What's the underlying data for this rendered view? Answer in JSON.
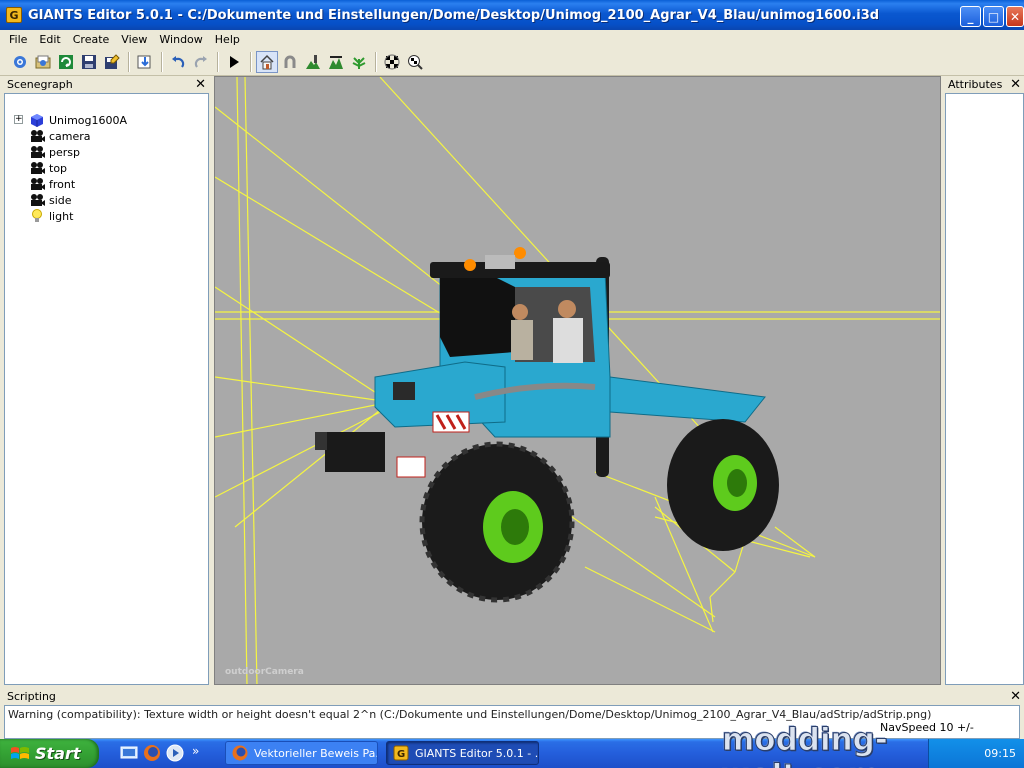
{
  "window": {
    "title": "GIANTS Editor 5.0.1 - C:/Dokumente und Einstellungen/Dome/Desktop/Unimog_2100_Agrar_V4_Blau/unimog1600.i3d",
    "app_icon_letter": "G",
    "minimize_glyph": "_",
    "maximize_glyph": "□",
    "close_glyph": "✕"
  },
  "menu": [
    "File",
    "Edit",
    "Create",
    "View",
    "Window",
    "Help"
  ],
  "toolbar": {
    "buttons": [
      "new-scene-icon",
      "open-icon",
      "reload-icon",
      "save-icon",
      "save-as-icon",
      "import-icon",
      "undo-icon",
      "redo-icon",
      "play-icon",
      "home-icon",
      "magnet-icon",
      "terrain-paint-icon",
      "terrain-sculpt-icon",
      "foliage-paint-icon",
      "checker-icon",
      "checker-view-icon"
    ],
    "active": "home-icon"
  },
  "scenegraph": {
    "title": "Scenegraph",
    "close_glyph": "✕",
    "expander_glyph": "+",
    "items": [
      {
        "label": "Unimog1600A",
        "icon": "transform-group-icon"
      },
      {
        "label": "camera",
        "icon": "camera-icon"
      },
      {
        "label": "persp",
        "icon": "camera-icon"
      },
      {
        "label": "top",
        "icon": "camera-icon"
      },
      {
        "label": "front",
        "icon": "camera-icon"
      },
      {
        "label": "side",
        "icon": "camera-icon"
      },
      {
        "label": "light",
        "icon": "light-bulb-icon"
      }
    ]
  },
  "viewport": {
    "camera_label": "outdoorCamera",
    "background": "#a9a9a9",
    "vehicle_color": "#2aa8cf",
    "rim_color": "#5ecb1d",
    "gizmo_color": "#f5f542"
  },
  "attributes": {
    "title": "Attributes",
    "close_glyph": "✕"
  },
  "scripting": {
    "title": "Scripting",
    "close_glyph": "✕",
    "warning": "Warning (compatibility): Texture width or height doesn't equal 2^n (C:/Dokumente und Einstellungen/Dome/Desktop/Unimog_2100_Agrar_V4_Blau/adStrip/adStrip.png)",
    "navspeed": "NavSpeed 10 +/-"
  },
  "taskbar": {
    "start_label": "Start",
    "quick_launch": [
      "show-desktop-icon",
      "firefox-icon",
      "media-player-icon"
    ],
    "overflow_glyph": "»",
    "tasks": [
      {
        "label": "Vektorieller Beweis Pa...",
        "icon": "firefox-icon"
      },
      {
        "label": "GIANTS Editor 5.0.1 - ...",
        "icon": "giants-editor-icon"
      }
    ],
    "clock": "09:15"
  },
  "watermark": "modding-welt.com"
}
